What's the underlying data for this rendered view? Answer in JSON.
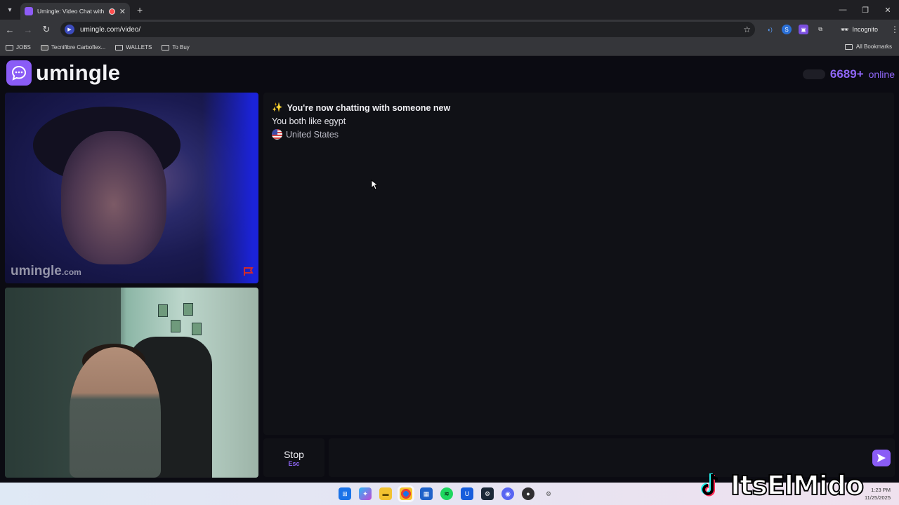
{
  "browser": {
    "tab_title": "Umingle: Video Chat with S",
    "url": "umingle.com/video/",
    "incognito_label": "Incognito",
    "bookmarks": [
      "JOBS",
      "Tecnifibre Carboflex...",
      "WALLETS",
      "To Buy"
    ],
    "all_bookmarks_label": "All Bookmarks"
  },
  "site": {
    "logo_text": "umingle",
    "online_count": "6689+",
    "online_label": "online",
    "accent_color": "#8a5cf6"
  },
  "remote_video": {
    "watermark": "umingle",
    "watermark_suffix": ".com"
  },
  "chat": {
    "sparkle": "✨",
    "system_message": "You're now chatting with someone new",
    "interests": "You both like egypt",
    "country": "United States"
  },
  "controls": {
    "stop_label": "Stop",
    "stop_shortcut": "Esc"
  },
  "taskbar": {
    "time": "1:23 PM",
    "date": "11/25/2025",
    "icons": [
      "windows-icon",
      "copilot-icon",
      "file-explorer-icon",
      "chrome-icon",
      "store-icon",
      "spotify-icon",
      "bitwarden-icon",
      "steam-icon",
      "discord-icon",
      "obs-icon",
      "settings-icon"
    ]
  },
  "overlay": {
    "handle": "ItsElMido"
  }
}
